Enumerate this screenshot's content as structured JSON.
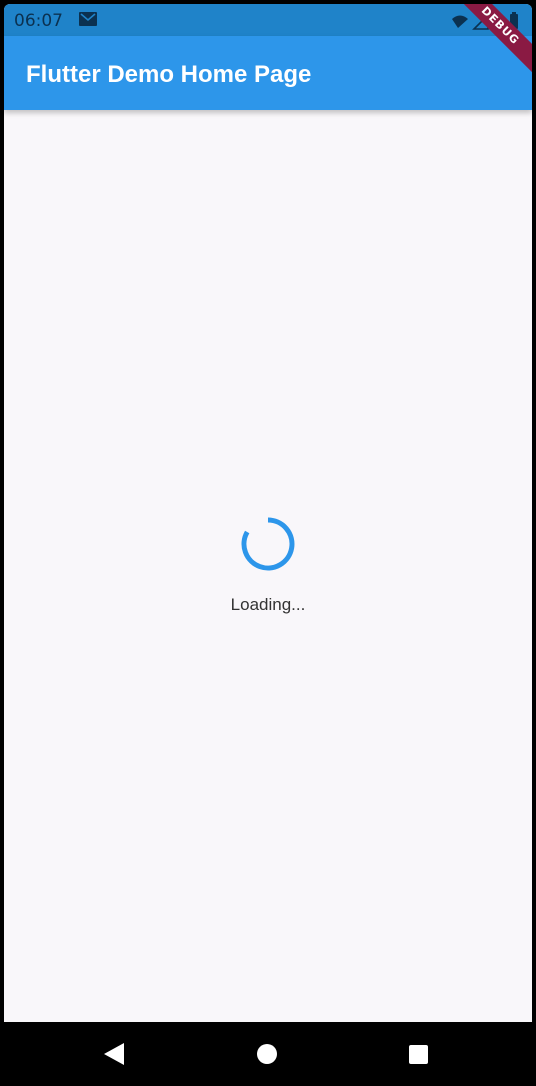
{
  "status_bar": {
    "time": "06:07",
    "icons": [
      "mail-icon",
      "wifi-icon",
      "signal-icon",
      "battery-icon"
    ]
  },
  "app_bar": {
    "title": "Flutter Demo Home Page"
  },
  "debug_banner": "DEBUG",
  "body": {
    "loading_text": "Loading...",
    "spinner_icon": "circular-progress-icon"
  },
  "nav_bar": {
    "icons": [
      "back-icon",
      "home-icon",
      "recents-icon"
    ]
  },
  "colors": {
    "primary": "#2d96ea",
    "status_bar": "#1f83c9",
    "background": "#f9f7fa",
    "debug_banner": "#8a1a43"
  }
}
